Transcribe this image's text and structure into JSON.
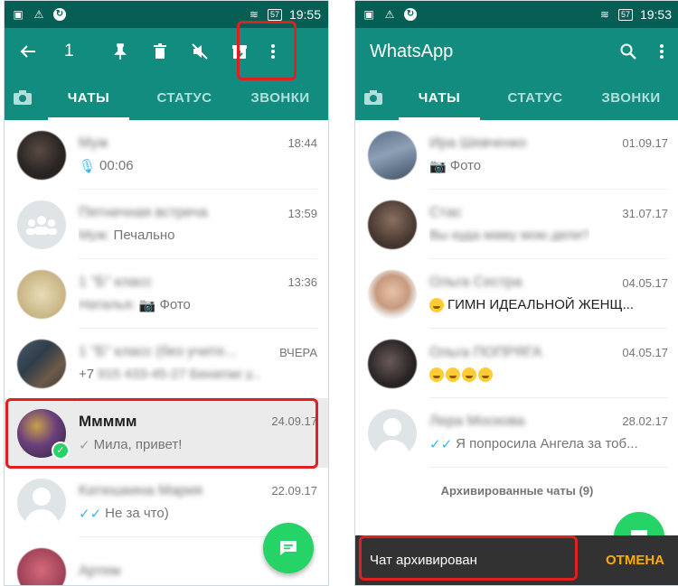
{
  "colors": {
    "primary_dark": "#075e54",
    "primary": "#128c7e",
    "accent": "#25d366",
    "highlight": "#e02020",
    "snack_action": "#ffab00"
  },
  "left": {
    "status": {
      "time": "19:55",
      "battery": "57"
    },
    "appbar": {
      "count": "1"
    },
    "tabs": {
      "chats": "ЧАТЫ",
      "status": "СТАТУС",
      "calls": "ЗВОНКИ"
    },
    "chats": [
      {
        "name": "Муж",
        "date": "18:44",
        "message": "00:06"
      },
      {
        "name": "Пятничная встреча",
        "date": "13:59",
        "sender": "Муж:",
        "message": "Печально"
      },
      {
        "name": "1 \"Б\" класс",
        "date": "13:36",
        "sender": "Наталья:",
        "message": "Фото"
      },
      {
        "name": "1 \"Б\" класс (без учите...",
        "date": "ВЧЕРА",
        "prefix": "+7",
        "blurred": "915 433-45-27 Бенатае у..."
      },
      {
        "name": "Ммммм",
        "date": "24.09.17",
        "message": "Мила, привет!"
      },
      {
        "name": "Катюшкина Мария",
        "date": "22.09.17",
        "message": "Не за что)"
      },
      {
        "name": "Артем",
        "date": "",
        "message": ""
      }
    ]
  },
  "right": {
    "status": {
      "time": "19:53",
      "battery": "57"
    },
    "appbar": {
      "title": "WhatsApp"
    },
    "tabs": {
      "chats": "ЧАТЫ",
      "status": "СТАТУС",
      "calls": "ЗВОНКИ"
    },
    "chats": [
      {
        "name": "Ира Шевченко",
        "date": "01.09.17",
        "message": "Фото"
      },
      {
        "name": "Стас",
        "date": "31.07.17",
        "message": "Вы куда маму мою дели?"
      },
      {
        "name": "Ольга Сестра",
        "date": "04.05.17",
        "message": "ГИМН ИДЕАЛЬНОЙ ЖЕНЩ..."
      },
      {
        "name": "Ольга ПОПРЯГА",
        "date": "04.05.17",
        "message": ""
      },
      {
        "name": "Лера Москова",
        "date": "28.02.17",
        "message": "Я попросила Ангела за тоб..."
      }
    ],
    "archived_label": "Архивированные чаты (9)",
    "snackbar": {
      "message": "Чат архивирован",
      "action": "ОТМЕНА"
    }
  }
}
